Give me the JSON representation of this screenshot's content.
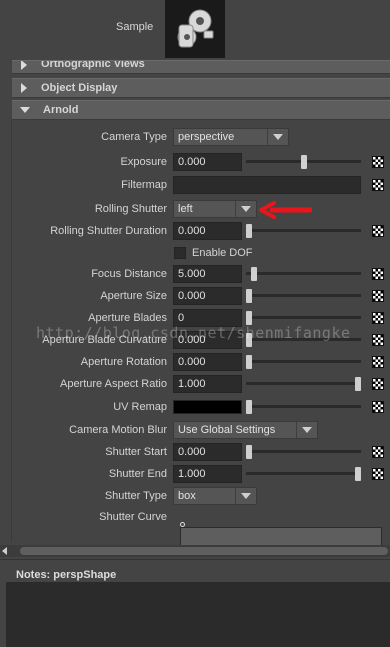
{
  "sample": {
    "label": "Sample"
  },
  "sections": {
    "orthographic": "Orthographic Views",
    "object_display": "Object Display",
    "arnold": "Arnold"
  },
  "attrs": {
    "camera_type": {
      "label": "Camera Type",
      "value": "perspective"
    },
    "exposure": {
      "label": "Exposure",
      "value": "0.000",
      "slider": 0.5
    },
    "filtermap": {
      "label": "Filtermap"
    },
    "rolling_shutter": {
      "label": "Rolling Shutter",
      "value": "left"
    },
    "rolling_shutter_duration": {
      "label": "Rolling Shutter Duration",
      "value": "0.000",
      "slider": 0.0
    },
    "enable_dof": {
      "label": "Enable DOF",
      "checked": false
    },
    "focus_distance": {
      "label": "Focus Distance",
      "value": "5.000",
      "slider": 0.05
    },
    "aperture_size": {
      "label": "Aperture Size",
      "value": "0.000",
      "slider": 0.0
    },
    "aperture_blades": {
      "label": "Aperture Blades",
      "value": "0",
      "slider": 0.0
    },
    "aperture_blade_curvature": {
      "label": "Aperture Blade Curvature",
      "value": "0.000",
      "slider": 0.0
    },
    "aperture_rotation": {
      "label": "Aperture Rotation",
      "value": "0.000",
      "slider": 0.0
    },
    "aperture_aspect_ratio": {
      "label": "Aperture Aspect Ratio",
      "value": "1.000",
      "slider": 1.0
    },
    "uv_remap": {
      "label": "UV Remap",
      "color": "#000000"
    },
    "camera_motion_blur": {
      "label": "Camera Motion Blur",
      "value": "Use Global Settings"
    },
    "shutter_start": {
      "label": "Shutter Start",
      "value": "0.000",
      "slider": 0.0
    },
    "shutter_end": {
      "label": "Shutter End",
      "value": "1.000",
      "slider": 1.0
    },
    "shutter_type": {
      "label": "Shutter Type",
      "value": "box"
    },
    "shutter_curve": {
      "label": "Shutter Curve"
    }
  },
  "notes": {
    "label": "Notes:  perspShape"
  },
  "watermark": "http://blog.csdn.net/shenmifangke",
  "colors": {
    "annotation_arrow": "#e8161b",
    "panel": "#444444",
    "field": "#2b2b2b"
  }
}
